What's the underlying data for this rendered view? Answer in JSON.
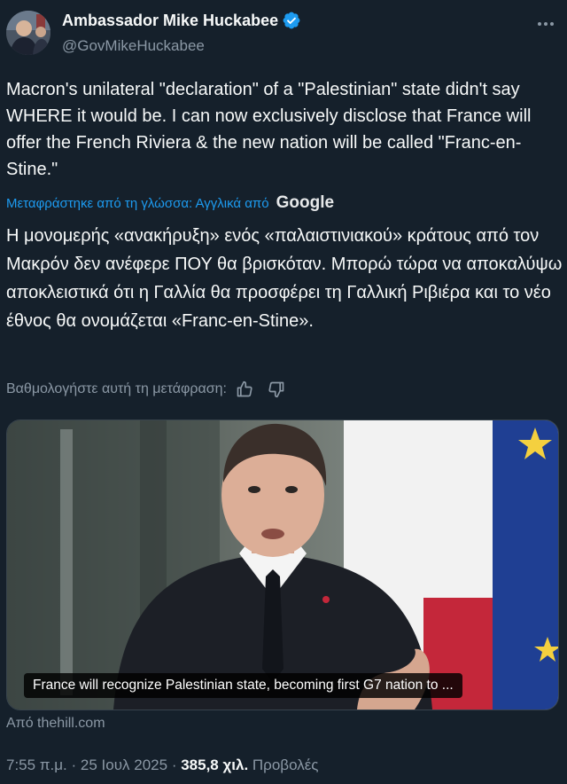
{
  "author": {
    "display_name": "Ambassador Mike Huckabee",
    "handle": "@GovMikeHuckabee"
  },
  "tweet": {
    "text": "Macron's unilateral \"declaration\" of a \"Palestinian\" state didn't say WHERE it would be. I can now exclusively disclose that France will offer the French Riviera & the new nation will be called \"Franc-en-Stine.\"",
    "translated_label": "Μεταφράστηκε από τη γλώσσα: Αγγλικά από",
    "translation_provider": "Google",
    "translation": "Η μονομερής «ανακήρυξη» ενός «παλαιστινιακού» κράτους από τον Μακρόν δεν ανέφερε ΠΟΥ θα βρισκόταν. Μπορώ τώρα να αποκαλύψω αποκλειστικά ότι η Γαλλία θα προσφέρει τη Γαλλική Ριβιέρα και το νέο έθνος θα ονομάζεται «Franc-en-Stine».",
    "rate_translation_label": "Βαθμολογήστε αυτή τη μετάφραση:"
  },
  "media": {
    "caption": "France will recognize Palestinian state, becoming first G7 nation to ...",
    "source": "Από thehill.com"
  },
  "meta": {
    "time": "7:55 π.μ.",
    "separator": "·",
    "date": "25 Ιουλ 2025",
    "views_count": "385,8 χιλ.",
    "views_label": "Προβολές"
  },
  "icons": {
    "verified": "verified-badge-icon",
    "more": "more-icon",
    "thumbs_up": "thumbs-up-icon",
    "thumbs_down": "thumbs-down-icon"
  },
  "colors": {
    "background": "#15202b",
    "accent": "#1d9bf0",
    "secondary_text": "#8b98a5"
  }
}
